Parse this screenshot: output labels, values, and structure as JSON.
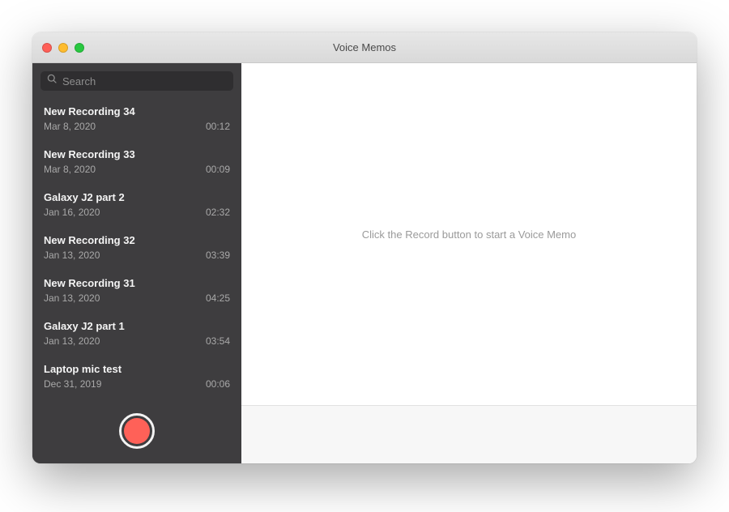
{
  "window": {
    "title": "Voice Memos"
  },
  "sidebar": {
    "search_placeholder": "Search",
    "items": [
      {
        "title": "New Recording 34",
        "date": "Mar 8, 2020",
        "duration": "00:12"
      },
      {
        "title": "New Recording 33",
        "date": "Mar 8, 2020",
        "duration": "00:09"
      },
      {
        "title": "Galaxy J2 part 2",
        "date": "Jan 16, 2020",
        "duration": "02:32"
      },
      {
        "title": "New Recording 32",
        "date": "Jan 13, 2020",
        "duration": "03:39"
      },
      {
        "title": "New Recording 31",
        "date": "Jan 13, 2020",
        "duration": "04:25"
      },
      {
        "title": "Galaxy J2 part 1",
        "date": "Jan 13, 2020",
        "duration": "03:54"
      },
      {
        "title": "Laptop mic test",
        "date": "Dec 31, 2019",
        "duration": "00:06"
      }
    ]
  },
  "main": {
    "placeholder": "Click the Record button to start a Voice Memo"
  }
}
